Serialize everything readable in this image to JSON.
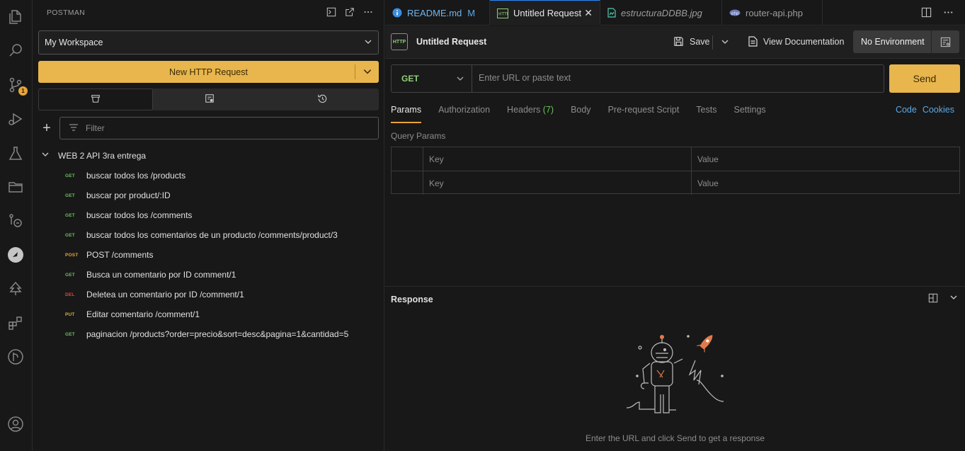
{
  "activity_bar": {
    "icons": [
      "explorer-icon",
      "search-icon",
      "source-control-icon",
      "run-debug-icon",
      "flask-icon",
      "folder-icon",
      "remote-icon",
      "postman-icon",
      "tree-icon",
      "extensions-icon",
      "git-graph-icon",
      "account-icon"
    ],
    "scm_badge": "1"
  },
  "sidebar": {
    "title": "POSTMAN",
    "workspace": "My Workspace",
    "new_request_label": "New HTTP Request",
    "filter_placeholder": "Filter",
    "collection": {
      "name": "WEB 2 API 3ra entrega",
      "requests": [
        {
          "method": "GET",
          "name": "buscar todos los /products"
        },
        {
          "method": "GET",
          "name": "buscar por product/:ID"
        },
        {
          "method": "GET",
          "name": "buscar todos los /comments"
        },
        {
          "method": "GET",
          "name": "buscar todos los comentarios de un producto /comments/product/3"
        },
        {
          "method": "POST",
          "name": "POST /comments"
        },
        {
          "method": "GET",
          "name": "Busca un comentario por ID comment/1"
        },
        {
          "method": "DEL",
          "name": "Deletea un comentario por ID /comment/1"
        },
        {
          "method": "PUT",
          "name": "Editar comentario /comment/1"
        },
        {
          "method": "GET",
          "name": "paginacion /products?order=precio&sort=desc&pagina=1&cantidad=5"
        }
      ]
    }
  },
  "editor_tabs": [
    {
      "label": "README.md",
      "modified": "M"
    },
    {
      "label": "Untitled Request",
      "active": true
    },
    {
      "label": "estructuraDDBB.jpg"
    },
    {
      "label": "router-api.php"
    }
  ],
  "request": {
    "badge": "HTTP",
    "title": "Untitled Request",
    "save_label": "Save",
    "view_doc_label": "View Documentation",
    "environment": "No Environment",
    "method": "GET",
    "url_placeholder": "Enter URL or paste text",
    "send_label": "Send",
    "tabs": [
      {
        "label": "Params",
        "active": true
      },
      {
        "label": "Authorization"
      },
      {
        "label": "Headers",
        "count": "(7)"
      },
      {
        "label": "Body"
      },
      {
        "label": "Pre-request Script"
      },
      {
        "label": "Tests"
      },
      {
        "label": "Settings"
      }
    ],
    "links": {
      "code": "Code",
      "cookies": "Cookies"
    },
    "query_params_label": "Query Params",
    "params_table": {
      "headers": {
        "key": "Key",
        "value": "Value"
      },
      "placeholder": {
        "key": "Key",
        "value": "Value"
      }
    }
  },
  "response": {
    "title": "Response",
    "hint": "Enter the URL and click Send to get a response"
  },
  "colors": {
    "accent": "#e8b64c",
    "get": "#6bbf5e",
    "post": "#e8a437",
    "delete": "#e0463b",
    "put": "#d8b53a",
    "link": "#5aa9e6"
  }
}
